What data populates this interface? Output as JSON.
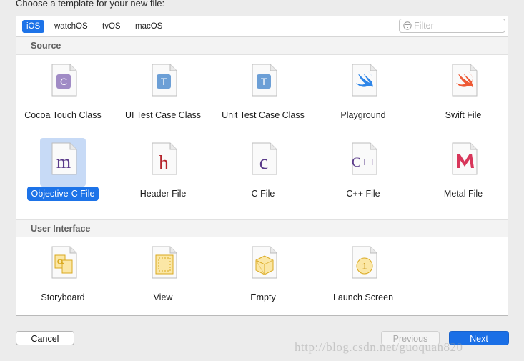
{
  "heading": "Choose a template for your new file:",
  "platforms": [
    {
      "label": "iOS",
      "active": true
    },
    {
      "label": "watchOS",
      "active": false
    },
    {
      "label": "tvOS",
      "active": false
    },
    {
      "label": "macOS",
      "active": false
    }
  ],
  "filter": {
    "placeholder": "Filter",
    "value": ""
  },
  "sections": [
    {
      "title": "Source",
      "items": [
        {
          "label": "Cocoa Touch Class",
          "icon": "objc-class-c-icon",
          "selected": false
        },
        {
          "label": "UI Test Case Class",
          "icon": "test-case-t-icon",
          "selected": false
        },
        {
          "label": "Unit Test Case Class",
          "icon": "test-case-t-icon",
          "selected": false
        },
        {
          "label": "Playground",
          "icon": "swift-playground-icon",
          "selected": false
        },
        {
          "label": "Swift File",
          "icon": "swift-file-icon",
          "selected": false
        },
        {
          "label": "Objective-C File",
          "icon": "objc-m-file-icon",
          "selected": true
        },
        {
          "label": "Header File",
          "icon": "header-h-file-icon",
          "selected": false
        },
        {
          "label": "C File",
          "icon": "c-file-icon",
          "selected": false
        },
        {
          "label": "C++ File",
          "icon": "cpp-file-icon",
          "selected": false
        },
        {
          "label": "Metal File",
          "icon": "metal-file-icon",
          "selected": false
        }
      ]
    },
    {
      "title": "User Interface",
      "items": [
        {
          "label": "Storyboard",
          "icon": "storyboard-icon",
          "selected": false
        },
        {
          "label": "View",
          "icon": "view-xib-icon",
          "selected": false
        },
        {
          "label": "Empty",
          "icon": "empty-ib-icon",
          "selected": false
        },
        {
          "label": "Launch Screen",
          "icon": "launch-screen-icon",
          "selected": false
        }
      ]
    }
  ],
  "buttons": {
    "cancel": "Cancel",
    "previous": "Previous",
    "next": "Next"
  },
  "watermark": "http://blog.csdn.net/guoquan820",
  "colors": {
    "accent": "#1d73e8",
    "selection_bg": "#c7daf6"
  }
}
